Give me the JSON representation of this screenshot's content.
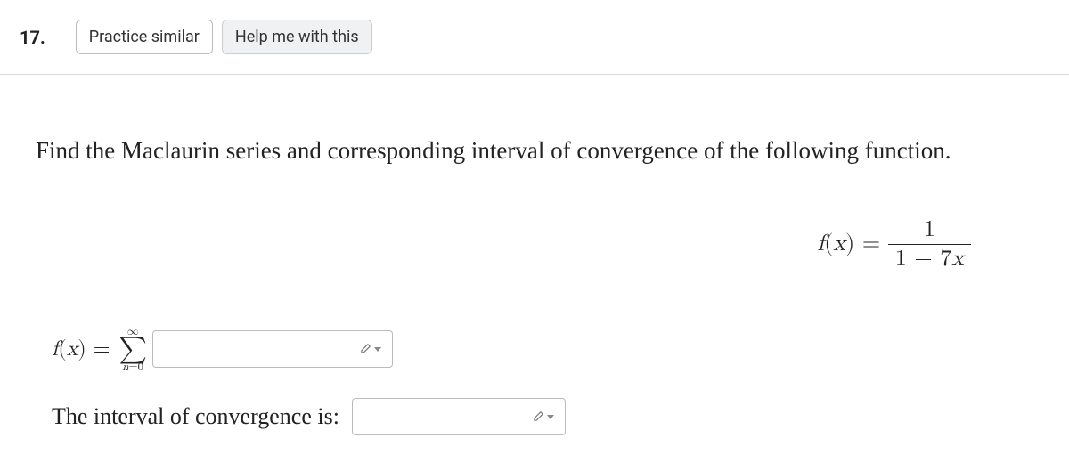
{
  "header": {
    "question_number": "17.",
    "practice_button": "Practice similar",
    "help_button": "Help me with this"
  },
  "prompt": "Find the Maclaurin series and corresponding interval of convergence of the following function.",
  "function": {
    "lhs_f": "f",
    "lhs_x": "x",
    "equals": "=",
    "numerator": "1",
    "denominator": "1 − 7x"
  },
  "sigma": {
    "top": "∞",
    "mid": "∑",
    "bottom_n": "n",
    "bottom_eq": "=0"
  },
  "answers": {
    "series_lhs_f": "f",
    "series_lhs_x": "x",
    "series_equals": "=",
    "interval_label": "The interval of convergence is:"
  }
}
